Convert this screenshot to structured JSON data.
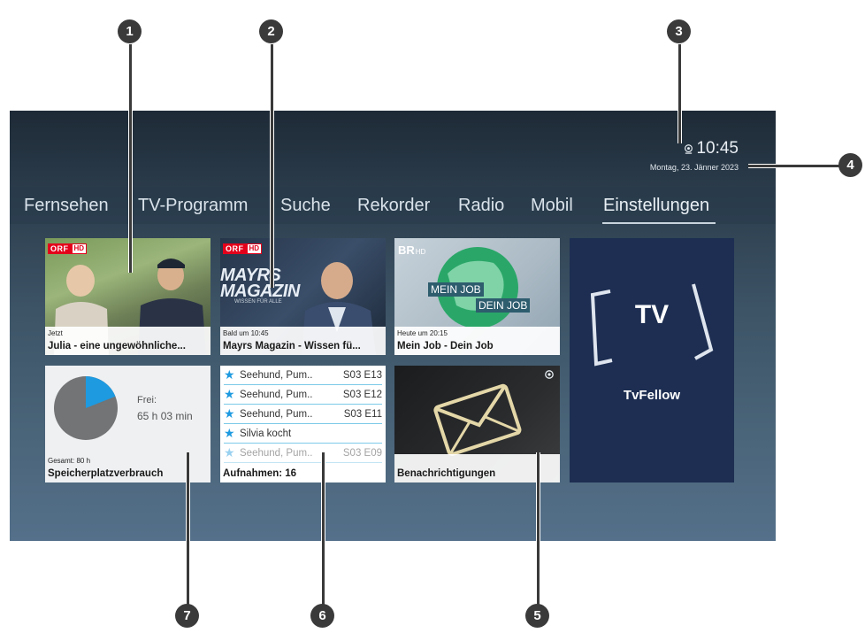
{
  "header": {
    "time": "10:45",
    "date": "Montag, 23. Jänner 2023"
  },
  "nav": {
    "items": [
      "Fernsehen",
      "TV-Programm",
      "Suche",
      "Rekorder",
      "Radio",
      "Mobil",
      "Einstellungen"
    ],
    "active": "Einstellungen"
  },
  "tiles": {
    "julia": {
      "channel": "ORF",
      "channel_hd": "HD",
      "status": "Jetzt",
      "title": "Julia - eine ungewöhnliche..."
    },
    "mayrs": {
      "channel": "ORF",
      "channel_hd": "HD",
      "status": "Bald um 10:45",
      "title": "Mayrs Magazin - Wissen fü...",
      "image_text": "MAYRS MAGAZIN",
      "image_subtext": "WISSEN FÜR ALLE"
    },
    "meinjob": {
      "channel": "BR",
      "channel_hd": "HD",
      "status": "Heute um 20:15",
      "title": "Mein Job - Dein Job",
      "image_text_1": "MEIN JOB",
      "image_text_2": "DEIN JOB"
    },
    "tvfellow": {
      "logo_text": "TV",
      "title": "TvFellow"
    },
    "storage": {
      "free_label": "Frei:",
      "free_value": "65 h 03 min",
      "total": "Gesamt: 80 h",
      "title": "Speicherplatzverbrauch",
      "used_fraction": 0.19
    },
    "recordings": {
      "items": [
        {
          "name": "Seehund, Pum..",
          "episode": "S03 E13"
        },
        {
          "name": "Seehund, Pum..",
          "episode": "S03 E12"
        },
        {
          "name": "Seehund, Pum..",
          "episode": "S03 E11"
        },
        {
          "name": "Silvia kocht",
          "episode": ""
        },
        {
          "name": "Seehund, Pum..",
          "episode": "S03 E09"
        }
      ],
      "title": "Aufnahmen: 16"
    },
    "notifications": {
      "title": "Benachrichtigungen"
    }
  },
  "callouts": [
    "1",
    "2",
    "3",
    "4",
    "5",
    "6",
    "7"
  ],
  "colors": {
    "accent_blue": "#1e9ae0",
    "orf_red": "#e3001b",
    "tvfellow_bg": "#1d2e52",
    "callout": "#3a3a3a"
  }
}
